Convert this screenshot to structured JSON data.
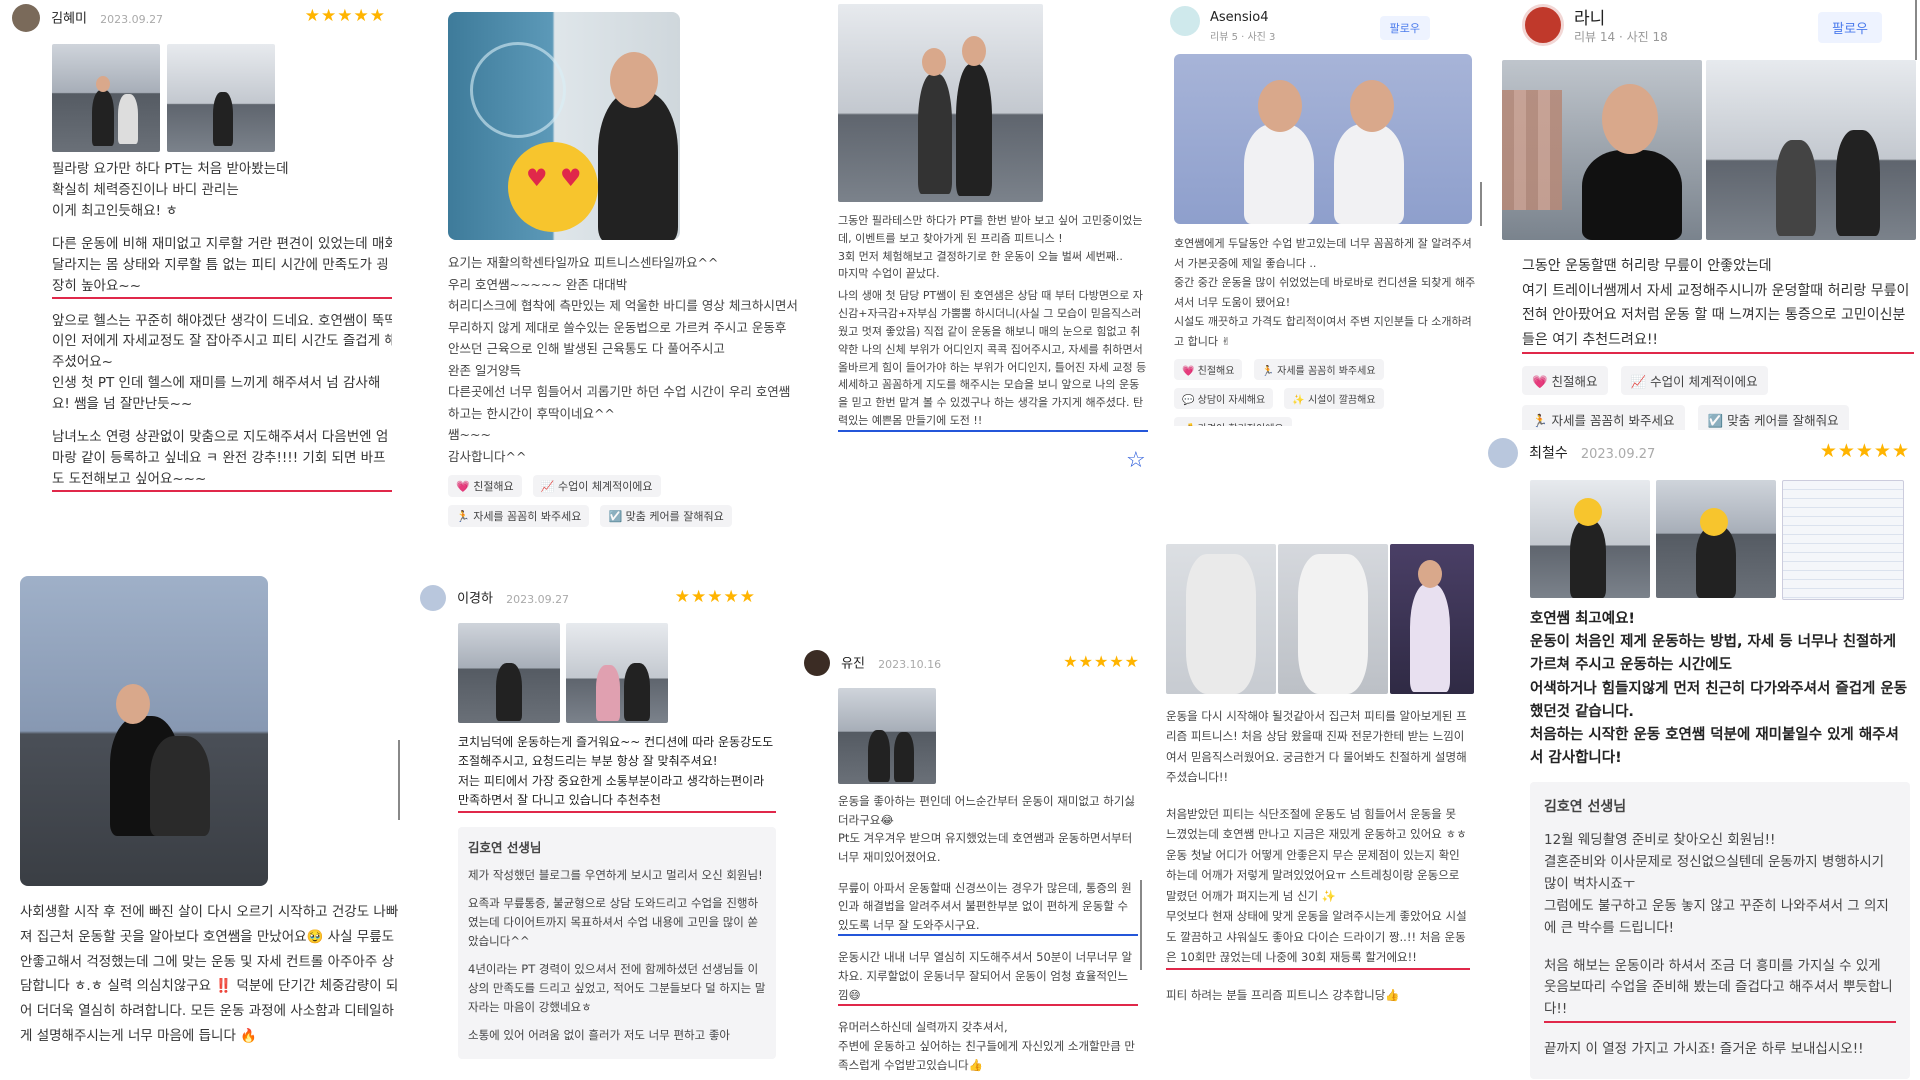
{
  "c1": {
    "name": "김혜미",
    "date": "2023.09.27",
    "stars": "★★★★★",
    "p1": "필라랑 요가만 하다 PT는 처음 받아봤는데\n확실히 체력증진이나 바디 관리는\n이게 최고인듯해요! ㅎ",
    "p2": "다른 운동에 비해 재미없고 지루할 거란 편견이 있었는데 매회 달라지는 몸 상태와 지루할 틈 없는 피티 시간에 만족도가 굉장히 높아요~~",
    "p3": "앞으로 헬스는 꾸준히 해야겠단 생각이 드네요. 호연쌤이 뚝딱이인 저에게 자세교정도 잘 잡아주시고 피티 시간도 즐겁게 해주셨어요~\n인생 첫 PT 인데 헬스에 재미를 느끼게 해주셔서 넘 감사해요! 쌤을 넘 잘만난듯~~",
    "p4": "남녀노소 연령 상관없이 맞춤으로 지도해주셔서 다음번엔 엄마랑 같이 등록하고 싶네요 ㅋ 완전 강추!!!! 기회 되면 바프도 도전해보고 싶어요~~~"
  },
  "c2": {
    "p": "요기는 재활의학센타일까요 피트니스센타일까요^^\n우리 호연쌤~~~~~ 완존 대대박\n허리디스크에 협착에 측만있는 제 억울한 바디를 영상 체크하시면서 무리하지 않게 제대로 쓸수있는 운동법으로 가르켜 주시고 운동후 안쓰던 근육으로 인해 발생된 근육통도 다 풀어주시고\n완존 일거양득\n다른곳에선 너무 힘들어서 괴롭기만 하던 수업 시간이 우리 호연쌤하고는 한시간이 후딱이네요^^\n쌤~~~\n감사합니다^^",
    "tags": [
      "💗 친절해요",
      "📈 수업이 체계적이에요",
      "🏃 자세를 꼼꼼히 봐주세요",
      "☑️ 맞춤 케어를 잘해줘요"
    ]
  },
  "c3": {
    "p1": "그동안 필라테스만 하다가 PT를 한번 받아 보고 싶어 고민중이었는데, 이벤트를 보고 찾아가게 된 프리즘 피트니스 !\n3회 먼저 체험해보고 결정하기로 한 운동이 오늘 벌써 세번째..\n마지막 수업이 끝났다.",
    "p2": "나의 생애 첫 담당 PT쌤이 된 호연샘은 상담 때 부터 다방면으로 자신감+자극감+자부심 가뿜뿜 하시더니(사실 그 모습이 믿음직스러웠고 멋져 좋았음) 직접 같이 운동을 해보니 매의 눈으로 힘없고 취약한 나의 신체 부위가 어디인지 콕콕 집어주시고, 자세를 취하면서 올바르게 힘이 들어가야 하는 부위가 어디인지, 틀어진 자세 교정 등 세세하고 꼼꼼하게 지도를 해주시는 모습을 보니 앞으로 나의 운동을 믿고 한번 맡겨 볼 수 있겠구나 하는 생각을 가지게 해주셨다. 탄력있는 예쁜몸 만들기에 도전 !!"
  },
  "c4": {
    "name": "Asensio4",
    "meta": "리뷰 5 · 사진 3",
    "follow": "팔로우",
    "p": "호연쌤에게 두달동안 수업 받고있는데 너무 꼼꼼하게 잘 알려주셔서 가본곳중에 제일 좋습니다 ..\n중간 중간 운동을 많이 쉬었었는데 바로바로 컨디션을 되찾게 해주셔서 너무 도움이 됐어요!\n시설도 깨끗하고 가격도 합리적이여서 주변 지인분들 다 소개하려고 합니다 ✌",
    "tags": [
      "💗 친절해요",
      "🏃 자세를 꼼꼼히 봐주세요",
      "💬 상담이 자세해요",
      "✨ 시설이 깔끔해요",
      "💰 가격이 합리적이에요"
    ]
  },
  "c5": {
    "name": "라니",
    "meta": "리뷰 14 · 사진 18",
    "follow": "팔로우",
    "p": "그동안 운동할땐 허리랑 무릎이 안좋았는데\n여기 트레이너쌤께서 자세 교정해주시니까 운덩할때 허리랑 무릎이 전혀 안아팠어요 저처럼 운동 할 때 느껴지는 통증으로 고민이신분들은 여기 추천드려요!!",
    "tags": [
      "💗 친절해요",
      "📈 수업이 체계적이에요",
      "🏃 자세를 꼼꼼히 봐주세요",
      "☑️ 맞춤 케어를 잘해줘요"
    ]
  },
  "c6": {
    "name": "최철수",
    "date": "2023.09.27",
    "stars": "★★★★★",
    "p": "호연쌤 최고예요!\n운동이 처음인 제게 운동하는 방법, 자세 등 너무나 친절하게 가르쳐 주시고 운동하는 시간에도\n어색하거나 힘들지않게 먼저 친근히 다가와주셔서 즐겁게 운동했던것 같습니다.\n처음하는 시작한 운동 호연쌤 덕분에 재미붙일수 있게 해주셔서 감사합니다!",
    "reply_title": "김호연 선생님",
    "reply1": "12월 웨딩촬영 준비로 찾아오신 회원님!!\n결혼준비와 이사문제로 정신없으실텐데 운동까지 병행하시기 많이 벅차시죠ㅜ\n그럼에도 불구하고 운동 놓지 않고 꾸준히 나와주셔서 그 의지에 큰 박수를 드립니다!",
    "reply2": "처음 해보는 운동이라 하셔서 조금 더 흥미를 가지실 수 있게 웃음보따리 수업을 준비해 봤는데 즐겁다고 해주셔서 뿌듯합니다!!",
    "reply3": "끝까지 이 열정 가지고 가시죠! 즐거운 하루 보내십시오!!"
  },
  "c7": {
    "p": "사회생활 시작 후 전에 빠진 살이 다시 오르기 시작하고 건강도 나빠져 집근처 운동할 곳을 알아보다 호연쌤을 만났어요🥹 사실 무릎도 안좋고해서 걱정했는데 그에 맞는 운동 및 자세 컨트롤 아주아주 상담합니다 ㅎ.ㅎ 실력 의심치않구요 ‼️ 덕분에 단기간 체중감량이 되어 더더욱 열심히 하려합니다. 모든 운동 과정에 사소함과 디테일하게 설명해주시는게 너무 마음에 듭니다 🔥"
  },
  "c8": {
    "name": "이경하",
    "date": "2023.09.27",
    "stars": "★★★★★",
    "p": "코치님덕에 운동하는게 즐거워요~~ 컨디션에 따라 운동강도도 조절해주시고, 요청드리는 부분 항상 잘 맞춰주셔요!\n저는 피티에서 가장 중요한게 소통부분이라고 생각하는편이라 만족하면서 잘 다니고 있습니다 추천추천",
    "reply_title": "김호연 선생님",
    "reply1": "제가 작성했던 블로그를 우연하게 보시고 멀리서 오신 회원님!",
    "reply2": "요족과 무릎통증, 불균형으로 상담 도와드리고 수업을 진행하였는데 다이어트까지 목표하셔서 수업 내용에 고민을 많이 쏟았습니다^^",
    "reply3": "4년이라는 PT 경력이 있으셔서 전에 함께하셨던 선생님들 이상의 만족도를 드리고 싶었고, 적어도 그분들보다 덜 하지는 말자라는 마음이 강했네요ㅎ",
    "reply4": "소통에 있어 어려움 없이 흘러가 저도 너무 편하고 좋아"
  },
  "c9": {
    "name": "유진",
    "date": "2023.10.16",
    "stars": "★★★★★",
    "p1": "운동을 좋아하는 편인데 어느순간부터 운동이 재미없고 하기싫더라구요😂\nPt도 겨우겨우 받으며 유지했었는데 호연쌤과 운동하면서부터 너무 재미있어졌어요.",
    "p2": "무릎이 아파서 운동할때 신경쓰이는 경우가 많은데, 통증의 원인과 해결법을 알려주셔서 불편한부분 없이 편하게 운동할 수 있도록 너무 잘 도와주시구요.",
    "p3": "운동시간 내내 너무 열심히 지도해주셔서 50분이 너무너무 알차요. 지루할없이 운동너무 잘되어서 운동이 엄청 효율적인느낌😄",
    "p4": "유머러스하신데 실력까지 갖추셔서,\n주변에 운동하고 싶어하는 친구들에게 자신있게 소개할만큼 만족스럽게 수업받고있습니다👍"
  },
  "c10": {
    "p1": "운동을 다시 시작해야 될것같아서 집근처 피티를 알아보게된 프리즘 피트니스! 처음 상담 왔을때 진짜 전문가한테 받는 느낌이여서 믿음직스러웠어요. 궁금한거 다 물어봐도 친절하게 설명해주셨습니다!!",
    "p2": "처음받았던 피티는 식단조절에 운동도 넘 힘들어서 운동을 못 느꼈었는데 호연쌤 만나고 지금은 재밌게 운동하고 있어요 ㅎㅎ\n운동 첫날 어디가 어떻게 안좋은지 무슨 문제점이 있는지 확인하는데 어깨가 저렇게 말려있었어요ㅠ 스트레칭이랑 운동으로 말렸던 어깨가 펴지는게 넘 신기 ✨\n무엇보다 현재 상태에 맞게 운동을 알려주시는게 좋았어요 시설도 깔끔하고 샤워실도 좋아요 다이슨 드라이기 짱..!! 처음 운동은 10회만 끊었는데 나중에 30회 재등록 할거에요!!",
    "p3": "피티 하려는 분들 프리즘 피트니스 강추합니당👍"
  }
}
